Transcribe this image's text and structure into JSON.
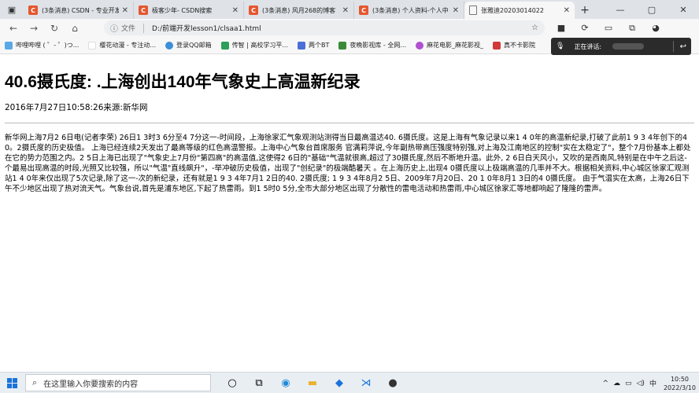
{
  "browser": {
    "tabs": [
      {
        "title": "(3条消息) CSDN - 专业开发",
        "icon": "C",
        "active": false
      },
      {
        "title": "极客少年- CSDN搜索",
        "icon": "C",
        "active": false
      },
      {
        "title": "(3条消息) 风月268的博客",
        "icon": "C",
        "active": false
      },
      {
        "title": "(3条消息) 个人资料-个人中",
        "icon": "C",
        "active": false
      },
      {
        "title": "张雅迪20203014022",
        "icon": "doc",
        "active": true
      }
    ],
    "address_label": "文件",
    "address_url": "D:/前端开发lesson1/clsaa1.html",
    "favorites": [
      {
        "label": "哔哩哔哩 ( ゜- ゜)つ...",
        "color": "#5aa9e6"
      },
      {
        "label": "樱花动漫 - 专注动...",
        "color": "#ffffff"
      },
      {
        "label": "登录QQ邮箱",
        "color": "#3b8fd9"
      },
      {
        "label": "传智 | 高校学习平...",
        "color": "#2e9e5a"
      },
      {
        "label": "两个BT",
        "color": "#4a6fd8"
      },
      {
        "label": "夜晚影视库 - 全网...",
        "color": "#3a8a3a"
      },
      {
        "label": "麻花电影_麻花影视_",
        "color": "#b14fd1"
      },
      {
        "label": "真不卡影院",
        "color": "#d23a3a"
      }
    ],
    "speaking_panel": {
      "label": "正在讲话:"
    }
  },
  "page": {
    "title": "40.6摄氏度: .上海创出140年气象史上高温新纪录",
    "meta": "2016年7月27日10:58:26来源:新华网",
    "body": "新华网上海7月2 6日电(记者李荣) 26日1 3时3 6分至4 7分这一-时间段，上海徐家汇气象观测站测得当日最高温达40. 6摄氏度。这是上海有气象记录以来1 4 0年的高温新纪录,打破了此前1 9 3 4年创下的40。2摄氏度的历史极值。 上海已经连续2天发出了最高等级的红色高温警报。上海中心气象台首席服务 官满莉萍说,今年副热带高压强度特别强,对上海及江南地区的控制\"实在太稳定了\"，整个7月份基本上都处在它的势力范围之内。2 5日上海已出现了\"气象史上7月份\"第四高\"的高温值,这使得2 6日的\"基础\"气温就很高,超过了30摄氏度,然后不断地升温。此外, 2 6日白天风小，又吹的是西南风,特别是在中午之后这-个最易出现高温的时段,光照又比较强，所以\"气温\"直线飙升\"，-举冲破历史极值，出现了\"创纪录\"的极端酷暑天 。在上海历史上,出现4 0摄氏度以上极端高温的几率并不大。根据相关资料,中心城区徐家汇观测站1 4 0年来仅出现了5次记录,除了这一-次的新纪录，还有就是1 9 3 4年7月1 2日的40. 2摄氏度; 1 9 3 4年8月2 5日、2009年7月20日、20 1 0年8月1 3日的4 0摄氏度。 由于气温实在太高，上海26日下午不少地区出现了热对流天气。气象台说,首先是浦东地区,下起了热雷雨。到1 5时0 5分,全市大部分地区出现了分散性的雷电活动和热雷雨,中心城区徐家汇等地都响起了隆隆的雷声。"
  },
  "taskbar": {
    "search_placeholder": "在这里输入你要搜索的内容",
    "time": "10:50",
    "date": "2022/3/10",
    "ime": "中"
  }
}
